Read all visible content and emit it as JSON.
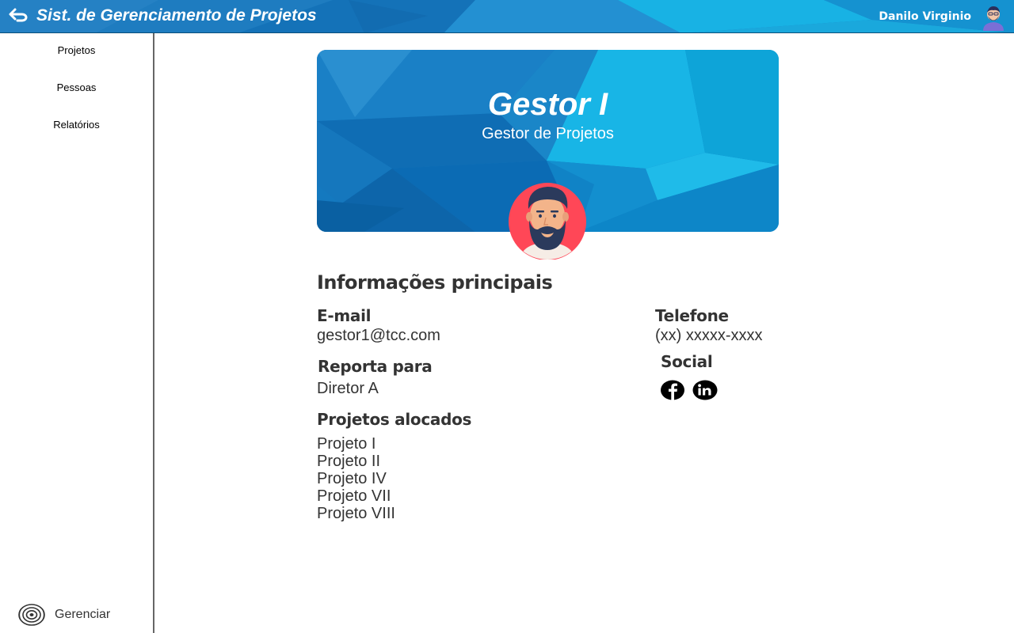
{
  "header": {
    "title": "Sist. de Gerenciamento de Projetos",
    "user_name": "Danilo Virginio",
    "back_icon": "back-arrow-icon",
    "avatar_icon": "user-avatar-icon"
  },
  "sidebar": {
    "items": [
      {
        "label": "Projetos"
      },
      {
        "label": "Pessoas"
      },
      {
        "label": "Relatórios"
      }
    ],
    "manage": {
      "label": "Gerenciar",
      "icon": "target-icon"
    }
  },
  "profile": {
    "name": "Gestor I",
    "role": "Gestor de Projetos",
    "avatar_icon": "bearded-man-avatar-icon"
  },
  "info": {
    "section_title": "Informações principais",
    "email": {
      "label": "E-mail",
      "value": "gestor1@tcc.com"
    },
    "reports_to": {
      "label": "Reporta para",
      "value": "Diretor A"
    },
    "projects": {
      "label": "Projetos alocados",
      "items": [
        "Projeto I",
        "Projeto II",
        "Projeto IV",
        "Projeto VII",
        "Projeto VIII"
      ]
    },
    "phone": {
      "label": "Telefone",
      "value": "(xx) xxxxx-xxxx"
    },
    "social": {
      "label": "Social",
      "icons": [
        "facebook-icon",
        "linkedin-icon"
      ]
    }
  },
  "colors": {
    "header_blue": "#1a7fc4",
    "banner_blue": "#1277bd",
    "banner_light": "#15b4e2",
    "text": "#333333",
    "avatar_bg": "#ff4757"
  }
}
